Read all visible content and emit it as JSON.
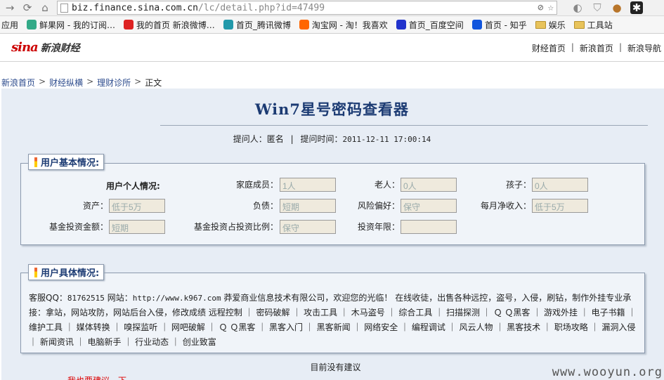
{
  "browser": {
    "url_host": "biz.finance.sina.com.cn",
    "url_path": "/lc/detail.php?id=47499",
    "bookmarks": [
      {
        "label": "应用",
        "icon": "apps-icon",
        "color": "#666"
      },
      {
        "label": "鲜果网 - 我的订阅…",
        "icon": "xianguo-icon",
        "color": "#3a8"
      },
      {
        "label": "我的首页 新浪微博…",
        "icon": "weibo-icon",
        "color": "#d22"
      },
      {
        "label": "首页_腾讯微博",
        "icon": "tencent-weibo-icon",
        "color": "#29a"
      },
      {
        "label": "淘宝网 - 淘！我喜欢",
        "icon": "taobao-icon",
        "color": "#f60"
      },
      {
        "label": "首页_百度空间",
        "icon": "baidu-icon",
        "color": "#23c"
      },
      {
        "label": "首页 - 知乎",
        "icon": "zhihu-icon",
        "color": "#15d"
      },
      {
        "label": "娱乐",
        "icon": "folder-icon",
        "color": "#e8c35a"
      },
      {
        "label": "工具站",
        "icon": "folder-icon",
        "color": "#e8c35a"
      }
    ]
  },
  "site": {
    "logo_main": "sina",
    "logo_sub": "新浪财经",
    "top_links": [
      "财经首页",
      "新浪首页",
      "新浪导航"
    ],
    "breadcrumb": [
      "新浪首页",
      "财经纵横",
      "理财诊所",
      "正文"
    ]
  },
  "article": {
    "title": "Win7星号密码查看器",
    "asker_label": "提问人：",
    "asker": "匿名",
    "time_label": "提问时间：",
    "time": "2011-12-11 17:00:14"
  },
  "basic": {
    "legend": "用户基本情况:",
    "personal_label": "用户个人情况:",
    "family_label": "家庭成员：",
    "family_value": "1人",
    "elder_label": "老人：",
    "elder_value": "0人",
    "child_label": "孩子：",
    "child_value": "0人",
    "assets_label": "资产：",
    "assets_value": "低于5万",
    "debt_label": "负债：",
    "debt_value": "短期",
    "risk_label": "风险偏好：",
    "risk_value": "保守",
    "income_label": "每月净收入：",
    "income_value": "低于5万",
    "fund_amount_label": "基金投资金额：",
    "fund_amount_value": "短期",
    "fund_ratio_label": "基金投资占投资比例：",
    "fund_ratio_value": "保守",
    "years_label": "投资年限：",
    "years_value": ""
  },
  "detail": {
    "legend": "用户具体情况:",
    "qq_label": "客服QQ：",
    "qq": "81762515",
    "site_label": "网站：",
    "site": "http://www.k967.com",
    "text": "莽爱商业信息技术有限公司，欢迎您的光临！ 在线收徒，出售各种远控，盗号，入侵，刷钻，制作外挂专业承接：拿站，网站攻防，网站后台入侵，修改成绩 远程控制 ｜ 密码破解 ｜ 攻击工具 ｜ 木马盗号 ｜ 综合工具 ｜ 扫描探测 ｜ Ｑ Ｑ黑客 ｜ 游戏外挂 ｜ 电子书籍 ｜ 维护工具 ｜ 媒体转换 ｜ 嗅探监听 ｜ 网吧破解 ｜ Ｑ Ｑ黑客 ｜ 黑客入门 ｜ 黑客新闻 ｜ 网络安全 ｜ 编程调试 ｜ 风云人物 ｜ 黑客技术 ｜ 职场攻略 ｜ 漏洞入侵 ｜ 新闻资讯 ｜ 电脑新手 ｜ 行业动态 ｜ 创业致富"
  },
  "footer": {
    "no_advice": "目前没有建议",
    "red_partial": "我也要建议一下",
    "watermark": "www.wooyun.org"
  }
}
